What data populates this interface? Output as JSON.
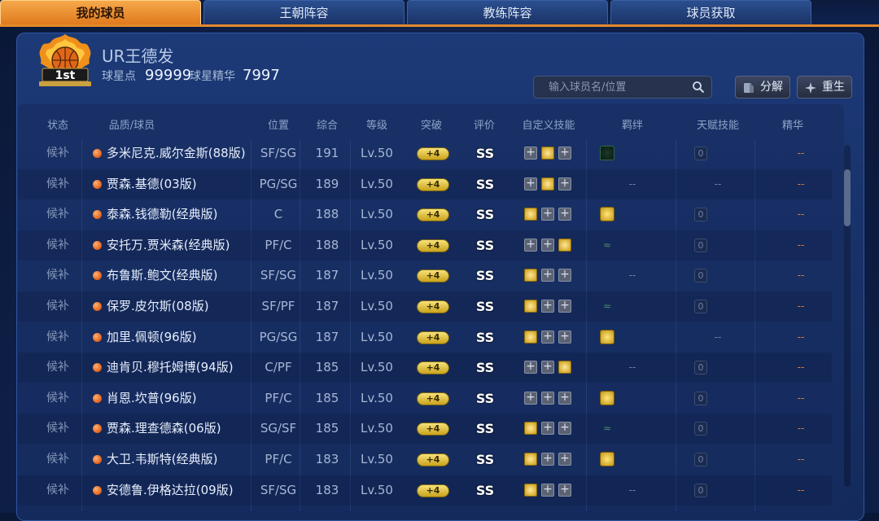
{
  "tabs": [
    "我的球员",
    "王朝阵容",
    "教练阵容",
    "球员获取"
  ],
  "active_tab": 0,
  "badge": {
    "text": "1st",
    "small": "2022 NATIONAL LEAGUE"
  },
  "profile": {
    "name": "UR王德发",
    "points_label": "球星点",
    "points_value": "99999",
    "essence_label": "球星精华",
    "essence_value": "7997"
  },
  "search": {
    "placeholder": "输入球员名/位置"
  },
  "buttons": {
    "decompose": "分解",
    "rebirth": "重生"
  },
  "headers": [
    "状态",
    "品质/球员",
    "位置",
    "综合",
    "等级",
    "突破",
    "评价",
    "自定义技能",
    "羁绊",
    "天赋技能",
    "精华"
  ],
  "rows": [
    {
      "status": "候补",
      "name": "多米尼克.威尔金斯(88版)",
      "pos": "SF/SG",
      "ovr": "191",
      "lv": "Lv.50",
      "break": "+4",
      "grade": "SS",
      "skills": [
        "plus",
        "gold",
        "plus"
      ],
      "bond": "green",
      "bond_text": "",
      "talent": "0",
      "essence": "--"
    },
    {
      "status": "候补",
      "name": "贾森.基德(03版)",
      "pos": "PG/SG",
      "ovr": "189",
      "lv": "Lv.50",
      "break": "+4",
      "grade": "SS",
      "skills": [
        "plus",
        "gold",
        "plus"
      ],
      "bond": "",
      "bond_text": "--",
      "talent": "--",
      "essence": "--"
    },
    {
      "status": "候补",
      "name": "泰森.钱德勒(经典版)",
      "pos": "C",
      "ovr": "188",
      "lv": "Lv.50",
      "break": "+4",
      "grade": "SS",
      "skills": [
        "gold",
        "plus",
        "plus"
      ],
      "bond": "gold",
      "bond_text": "",
      "talent": "0",
      "essence": "--"
    },
    {
      "status": "候补",
      "name": "安托万.贾米森(经典版)",
      "pos": "PF/C",
      "ovr": "188",
      "lv": "Lv.50",
      "break": "+4",
      "grade": "SS",
      "skills": [
        "plus",
        "plus",
        "gold"
      ],
      "bond": "dark",
      "bond_text": "",
      "talent": "0",
      "essence": "--"
    },
    {
      "status": "候补",
      "name": "布鲁斯.鲍文(经典版)",
      "pos": "SF/SG",
      "ovr": "187",
      "lv": "Lv.50",
      "break": "+4",
      "grade": "SS",
      "skills": [
        "gold",
        "plus",
        "plus"
      ],
      "bond": "",
      "bond_text": "--",
      "talent": "0",
      "essence": "--"
    },
    {
      "status": "候补",
      "name": "保罗.皮尔斯(08版)",
      "pos": "SF/PF",
      "ovr": "187",
      "lv": "Lv.50",
      "break": "+4",
      "grade": "SS",
      "skills": [
        "gold",
        "plus",
        "plus"
      ],
      "bond": "dark",
      "bond_text": "",
      "talent": "0",
      "essence": "--"
    },
    {
      "status": "候补",
      "name": "加里.佩顿(96版)",
      "pos": "PG/SG",
      "ovr": "187",
      "lv": "Lv.50",
      "break": "+4",
      "grade": "SS",
      "skills": [
        "gold",
        "plus",
        "plus"
      ],
      "bond": "gold",
      "bond_text": "",
      "talent": "--",
      "essence": "--"
    },
    {
      "status": "候补",
      "name": "迪肯贝.穆托姆博(94版)",
      "pos": "C/PF",
      "ovr": "185",
      "lv": "Lv.50",
      "break": "+4",
      "grade": "SS",
      "skills": [
        "plus",
        "plus",
        "gold"
      ],
      "bond": "",
      "bond_text": "--",
      "talent": "0",
      "essence": "--"
    },
    {
      "status": "候补",
      "name": "肖恩.坎普(96版)",
      "pos": "PF/C",
      "ovr": "185",
      "lv": "Lv.50",
      "break": "+4",
      "grade": "SS",
      "skills": [
        "plus",
        "plus",
        "plus"
      ],
      "bond": "gold",
      "bond_text": "",
      "talent": "0",
      "essence": "--"
    },
    {
      "status": "候补",
      "name": "贾森.理查德森(06版)",
      "pos": "SG/SF",
      "ovr": "185",
      "lv": "Lv.50",
      "break": "+4",
      "grade": "SS",
      "skills": [
        "gold",
        "plus",
        "plus"
      ],
      "bond": "dark",
      "bond_text": "",
      "talent": "0",
      "essence": "--"
    },
    {
      "status": "候补",
      "name": "大卫.韦斯特(经典版)",
      "pos": "PF/C",
      "ovr": "183",
      "lv": "Lv.50",
      "break": "+4",
      "grade": "SS",
      "skills": [
        "gold",
        "plus",
        "plus"
      ],
      "bond": "gold",
      "bond_text": "",
      "talent": "0",
      "essence": "--"
    },
    {
      "status": "候补",
      "name": "安德鲁.伊格达拉(09版)",
      "pos": "SF/SG",
      "ovr": "183",
      "lv": "Lv.50",
      "break": "+4",
      "grade": "SS",
      "skills": [
        "gold",
        "plus",
        "plus"
      ],
      "bond": "",
      "bond_text": "--",
      "talent": "0",
      "essence": "--"
    }
  ],
  "colors": {
    "active_tab": "#f0962f",
    "panel": "#1a3570",
    "row_dot": "#e8702a",
    "pill": "#e8c84a"
  }
}
